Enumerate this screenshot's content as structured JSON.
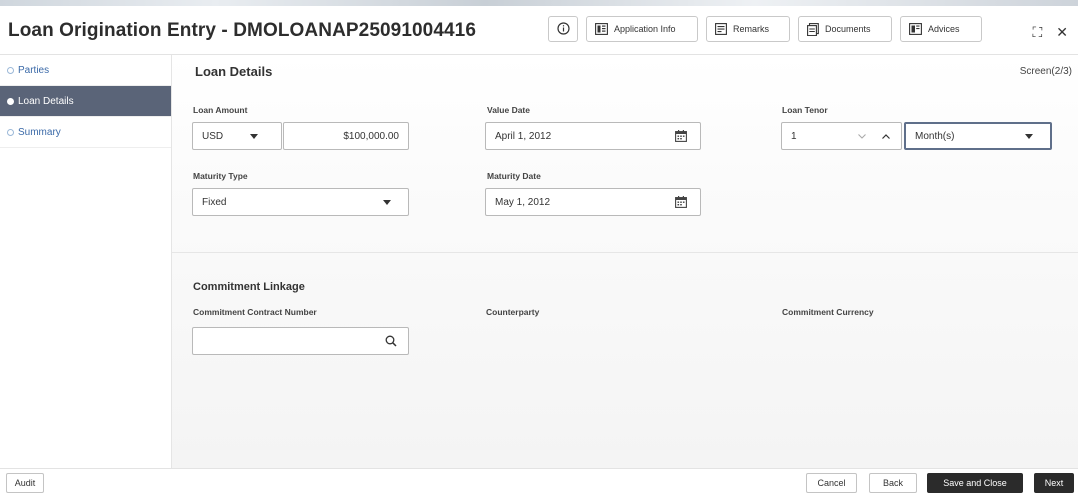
{
  "header": {
    "title": "Loan Origination Entry - DMOLOANAP25091004416",
    "buttons": {
      "info_icon": "info-icon",
      "application_info": "Application Info",
      "remarks": "Remarks",
      "documents": "Documents",
      "advices": "Advices"
    },
    "window": {
      "expand_glyph": "⛶",
      "close_glyph": "✕"
    }
  },
  "sidebar": {
    "items": [
      {
        "label": "Parties"
      },
      {
        "label": "Loan Details"
      },
      {
        "label": "Summary"
      }
    ],
    "active_color": "#5a6478"
  },
  "main": {
    "section_title": "Loan Details",
    "screen_indicator": "Screen(2/3)",
    "loan_amount": {
      "label": "Loan Amount",
      "currency": "USD",
      "value": "$100,000.00"
    },
    "value_date": {
      "label": "Value Date",
      "value": "April 1, 2012"
    },
    "loan_tenor": {
      "label": "Loan Tenor",
      "value": "1",
      "unit": "Month(s)"
    },
    "maturity_type": {
      "label": "Maturity Type",
      "value": "Fixed"
    },
    "maturity_date": {
      "label": "Maturity Date",
      "value": "May 1, 2012"
    },
    "commitment": {
      "title": "Commitment Linkage",
      "contract_number_label": "Commitment Contract Number",
      "contract_number_value": "",
      "counterparty_label": "Counterparty",
      "currency_label": "Commitment Currency"
    }
  },
  "footer": {
    "audit": "Audit",
    "cancel": "Cancel",
    "back": "Back",
    "save_close": "Save and Close",
    "next": "Next",
    "primary_color": "#2b2b2b"
  }
}
